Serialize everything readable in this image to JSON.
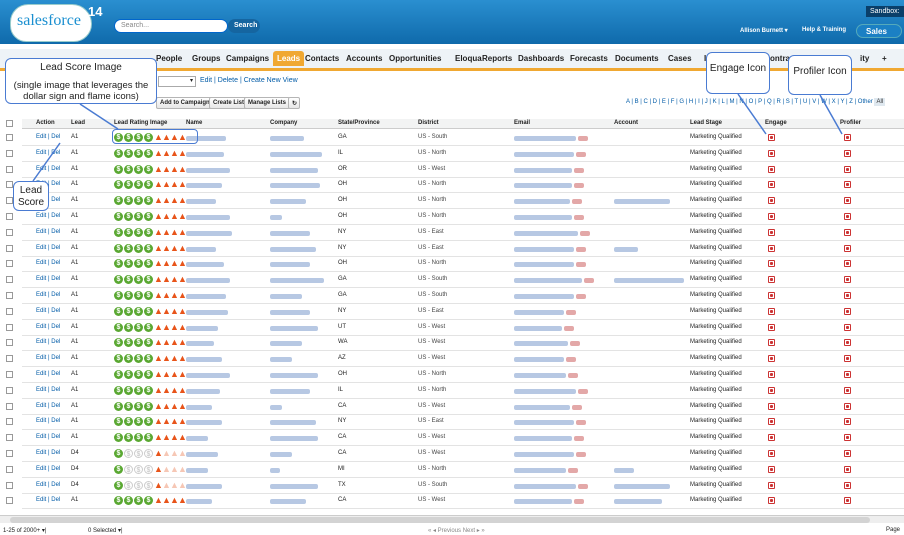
{
  "header": {
    "logo_text": "salesforce",
    "version": "14",
    "search_placeholder": "Search...",
    "search_button": "Search",
    "user": "Allison Burnett ▾",
    "help": "Help & Training",
    "sandbox": "Sandbox:",
    "app_button": "Sales"
  },
  "tabs": [
    "People",
    "Groups",
    "Campaigns",
    "Leads",
    "Contacts",
    "Accounts",
    "Opportunities",
    "Eloqua",
    "Reports",
    "Dashboards",
    "Forecasts",
    "Documents",
    "Cases",
    "Ide",
    "ontract",
    "ity",
    "+"
  ],
  "active_tab": "Leads",
  "view": {
    "selected": "▾",
    "links": "Edit | Delete | Create New View"
  },
  "buttons": {
    "add_to_campaign": "Add to Campaign",
    "create_list": "Create List",
    "manage_lists": "Manage Lists"
  },
  "alphabet": "A | B | C | D | E | F | G | H | I | J | K | L | M | N | O | P | Q | R | S | T | U | V | W | X | Y | Z | Other",
  "alphabet_current": "All",
  "columns": {
    "action": "Action",
    "score": "Lead",
    "rating_image": "Lead Rating Image",
    "name": "Name",
    "company": "Company",
    "state": "State/Province",
    "district": "District",
    "email": "Email",
    "account": "Account",
    "lead_stage": "Lead Stage",
    "engage": "Engage",
    "profiler": "Profiler"
  },
  "rows": [
    {
      "actions": "Edit | Del",
      "score": "A1",
      "coins": 4,
      "flames": 4,
      "state": "GA",
      "district": "US - South",
      "stage": "Marketing Qualified"
    },
    {
      "actions": "Edit | Del",
      "score": "A1",
      "coins": 4,
      "flames": 4,
      "state": "IL",
      "district": "US - North",
      "stage": "Marketing Qualified"
    },
    {
      "actions": "Edit | Del",
      "score": "A1",
      "coins": 4,
      "flames": 4,
      "state": "OR",
      "district": "US - West",
      "stage": "Marketing Qualified"
    },
    {
      "actions": "Edit | Del",
      "score": "A1",
      "coins": 4,
      "flames": 4,
      "state": "OH",
      "district": "US - North",
      "stage": "Marketing Qualified"
    },
    {
      "actions": "Edit | Del",
      "score": "A1",
      "coins": 4,
      "flames": 4,
      "state": "OH",
      "district": "US - North",
      "stage": "Marketing Qualified"
    },
    {
      "actions": "Edit | Del",
      "score": "A1",
      "coins": 4,
      "flames": 4,
      "state": "OH",
      "district": "US - North",
      "stage": "Marketing Qualified"
    },
    {
      "actions": "Edit | Del",
      "score": "A1",
      "coins": 4,
      "flames": 4,
      "state": "NY",
      "district": "US - East",
      "stage": "Marketing Qualified"
    },
    {
      "actions": "Edit | Del",
      "score": "A1",
      "coins": 4,
      "flames": 4,
      "state": "NY",
      "district": "US - East",
      "stage": "Marketing Qualified"
    },
    {
      "actions": "Edit | Del",
      "score": "A1",
      "coins": 4,
      "flames": 4,
      "state": "OH",
      "district": "US - North",
      "stage": "Marketing Qualified"
    },
    {
      "actions": "Edit | Del",
      "score": "A1",
      "coins": 4,
      "flames": 4,
      "state": "GA",
      "district": "US - South",
      "stage": "Marketing Qualified"
    },
    {
      "actions": "Edit | Del",
      "score": "A1",
      "coins": 4,
      "flames": 4,
      "state": "GA",
      "district": "US - South",
      "stage": "Marketing Qualified"
    },
    {
      "actions": "Edit | Del",
      "score": "A1",
      "coins": 4,
      "flames": 4,
      "state": "NY",
      "district": "US - East",
      "stage": "Marketing Qualified"
    },
    {
      "actions": "Edit | Del",
      "score": "A1",
      "coins": 4,
      "flames": 4,
      "state": "UT",
      "district": "US - West",
      "stage": "Marketing Qualified"
    },
    {
      "actions": "Edit | Del",
      "score": "A1",
      "coins": 4,
      "flames": 4,
      "state": "WA",
      "district": "US - West",
      "stage": "Marketing Qualified"
    },
    {
      "actions": "Edit | Del",
      "score": "A1",
      "coins": 4,
      "flames": 4,
      "state": "AZ",
      "district": "US - West",
      "stage": "Marketing Qualified"
    },
    {
      "actions": "Edit | Del",
      "score": "A1",
      "coins": 4,
      "flames": 4,
      "state": "OH",
      "district": "US - North",
      "stage": "Marketing Qualified"
    },
    {
      "actions": "Edit | Del",
      "score": "A1",
      "coins": 4,
      "flames": 4,
      "state": "IL",
      "district": "US - North",
      "stage": "Marketing Qualified"
    },
    {
      "actions": "Edit | Del",
      "score": "A1",
      "coins": 4,
      "flames": 4,
      "state": "CA",
      "district": "US - West",
      "stage": "Marketing Qualified"
    },
    {
      "actions": "Edit | Del",
      "score": "A1",
      "coins": 4,
      "flames": 4,
      "state": "NY",
      "district": "US - East",
      "stage": "Marketing Qualified"
    },
    {
      "actions": "Edit | Del",
      "score": "A1",
      "coins": 4,
      "flames": 4,
      "state": "CA",
      "district": "US - West",
      "stage": "Marketing Qualified"
    },
    {
      "actions": "Edit | Del",
      "score": "D4",
      "coins": 1,
      "flames": 1,
      "state": "CA",
      "district": "US - West",
      "stage": "Marketing Qualified"
    },
    {
      "actions": "Edit | Del",
      "score": "D4",
      "coins": 1,
      "flames": 1,
      "state": "MI",
      "district": "US - North",
      "stage": "Marketing Qualified"
    },
    {
      "actions": "Edit | Del",
      "score": "D4",
      "coins": 1,
      "flames": 1,
      "state": "TX",
      "district": "US - South",
      "stage": "Marketing Qualified"
    },
    {
      "actions": "Edit | Del",
      "score": "A1",
      "coins": 4,
      "flames": 4,
      "state": "CA",
      "district": "US - West",
      "stage": "Marketing Qualified"
    }
  ],
  "footer": {
    "count": "1-25 of 2000+ ▾|",
    "selected": "0 Selected ▾|",
    "pager": "« ◂ Previous  Next ▸ »",
    "page": "Page"
  },
  "callouts": {
    "lead_score_image_title": "Lead Score Image",
    "lead_score_image_note": "(single image that leverages the dollar sign and flame icons)",
    "lead_score": "Lead Score",
    "engage": "Engage Icon",
    "profiler": "Profiler Icon"
  },
  "colors": {
    "header": "#1a7fc2",
    "tab_active": "#f0a832",
    "coin": "#5aa832",
    "flame": "#e8541a",
    "callout_border": "#4a7bd2"
  }
}
